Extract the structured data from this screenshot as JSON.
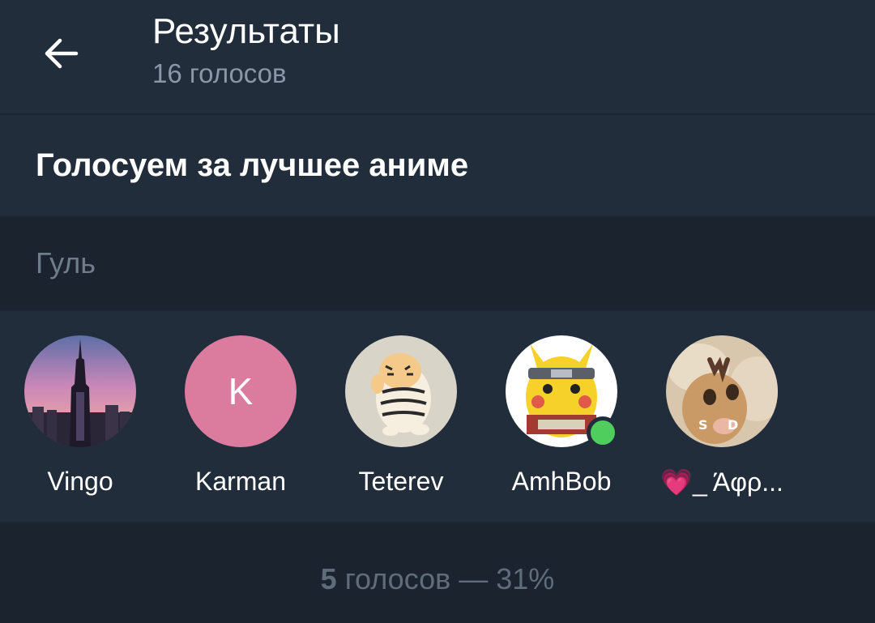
{
  "header": {
    "back_icon": "arrow-left-icon",
    "title": "Результаты",
    "subtitle": "16 голосов"
  },
  "question": {
    "text": "Голосуем за лучшее аниме"
  },
  "option": {
    "label": "Гуль"
  },
  "voters": [
    {
      "name": "Vingo",
      "avatar": "city-skyline-photo"
    },
    {
      "name": "Karman",
      "avatar_letter": "K",
      "avatar_color": "#db7c9f"
    },
    {
      "name": "Teterev",
      "avatar": "tiger-cat-drawing"
    },
    {
      "name": "AmhBob",
      "avatar": "pikachu-naruto-image",
      "online": true,
      "online_color": "#4fce5d"
    },
    {
      "name": "💗_ Άφρ...",
      "avatar": "cat-photo"
    }
  ],
  "footer": {
    "count": "5",
    "rest": " голосов — 31%"
  },
  "colors": {
    "background": "#1d2733",
    "panel": "#212d3b",
    "section_dark": "#1a232e",
    "text_primary": "#ffffff",
    "text_secondary": "#8a97a6"
  }
}
